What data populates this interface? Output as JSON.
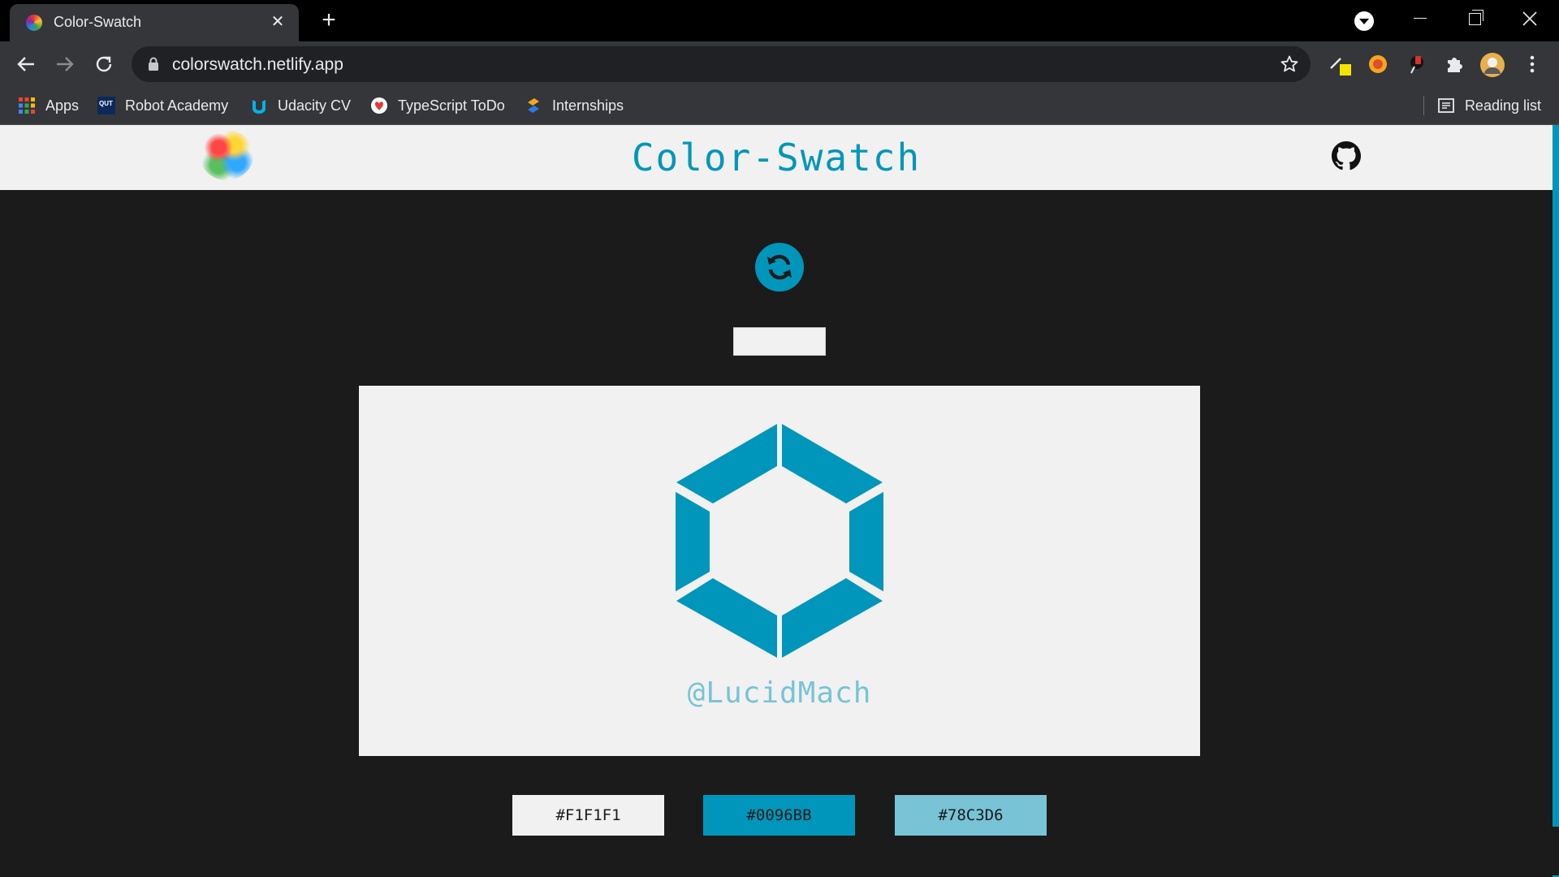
{
  "browser": {
    "tab": {
      "title": "Color-Swatch",
      "close": "✕"
    },
    "new_tab": "+",
    "address": {
      "url": "colorswatch.netlify.app"
    },
    "bookmarks": [
      {
        "label": "Apps",
        "icon": "apps-grid-icon"
      },
      {
        "label": "Robot Academy",
        "icon": "qut-icon"
      },
      {
        "label": "Udacity CV",
        "icon": "udacity-icon"
      },
      {
        "label": "TypeScript ToDo",
        "icon": "todo-icon"
      },
      {
        "label": "Internships",
        "icon": "internships-icon"
      }
    ],
    "reading_list": "Reading list"
  },
  "site": {
    "title": "Color-Swatch",
    "input_value": "",
    "handle": "@LucidMach"
  },
  "swatches": [
    {
      "label": "#F1F1F1",
      "color": "#F1F1F1"
    },
    {
      "label": "#0096BB",
      "color": "#0096BB"
    },
    {
      "label": "#78C3D6",
      "color": "#78C3D6"
    }
  ],
  "colors": {
    "accent": "#0096bb",
    "light": "#f1f1f1",
    "accent_light": "#78c3d6",
    "background": "#1b1b1b"
  }
}
